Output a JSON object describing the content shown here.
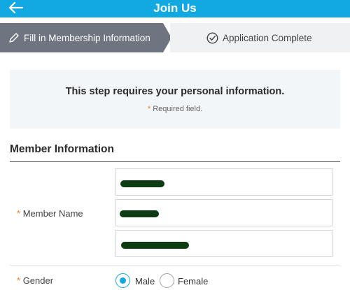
{
  "header": {
    "back_icon": "arrow-left-icon",
    "title": "Join Us",
    "color": "#12a9e3"
  },
  "steps": [
    {
      "label": "Fill in Membership Information",
      "icon": "pencil-icon",
      "state": "active"
    },
    {
      "label": "Application Complete",
      "icon": "check-circle-icon",
      "state": "pending"
    }
  ],
  "notice": {
    "message": "This step requires your personal information.",
    "required_mark": "*",
    "required_text": "Required field."
  },
  "section": {
    "title": "Member Information"
  },
  "form": {
    "member_name": {
      "required_mark": "*",
      "label": "Member Name",
      "inputs": [
        {
          "value": "",
          "redacted": true
        },
        {
          "value": "",
          "redacted": true
        },
        {
          "value": "",
          "redacted": true
        }
      ]
    },
    "gender": {
      "required_mark": "*",
      "label": "Gender",
      "options": [
        {
          "label": "Male",
          "selected": true
        },
        {
          "label": "Female",
          "selected": false
        }
      ]
    }
  },
  "colors": {
    "accent": "#12a9e3",
    "required": "#e67e22",
    "active_step": "#6e7580",
    "redaction": "#0d3b12"
  }
}
